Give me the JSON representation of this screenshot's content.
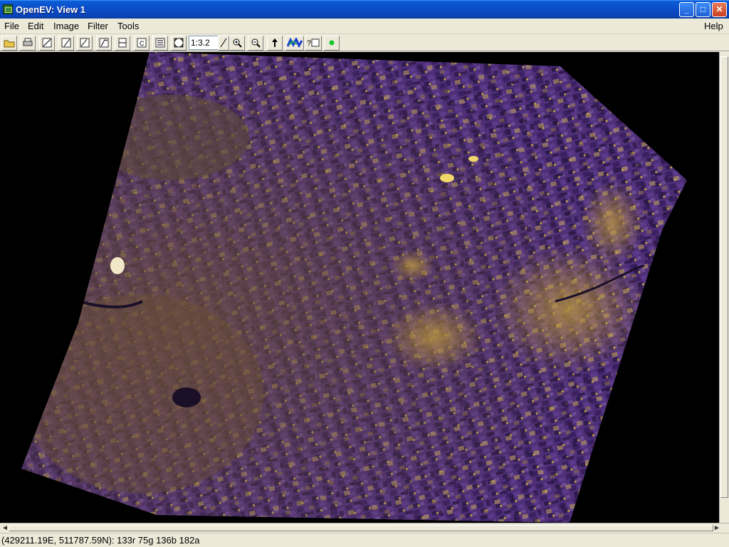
{
  "window": {
    "title": "OpenEV: View 1"
  },
  "window_controls": {
    "minimize": "_",
    "maximize": "□",
    "close": "✕"
  },
  "menu": {
    "file": "File",
    "edit": "Edit",
    "image": "Image",
    "filter": "Filter",
    "tools": "Tools",
    "help": "Help"
  },
  "toolbar": {
    "icons": [
      "open-icon",
      "print-icon",
      "draw-line-icon",
      "draw-poly-icon",
      "select-icon",
      "edit-icon",
      "fit-icon",
      "copy-icon",
      "table-icon",
      "fullextent-icon"
    ],
    "zoom_value": "1:3.2",
    "after_zoom_icons": [
      "zoom-in-icon",
      "zoom-out-icon",
      "north-arrow-icon",
      "legend-icon",
      "info-icon",
      "green-dot-icon"
    ]
  },
  "status": {
    "text": "(429211.19E, 511787.59N): 133r 75g 136b 182a"
  },
  "colors": {
    "titlebar": "#0a4ec9",
    "image_base": "#4a2f6e",
    "image_highlight": "#c8b05a",
    "background": "#000000"
  }
}
